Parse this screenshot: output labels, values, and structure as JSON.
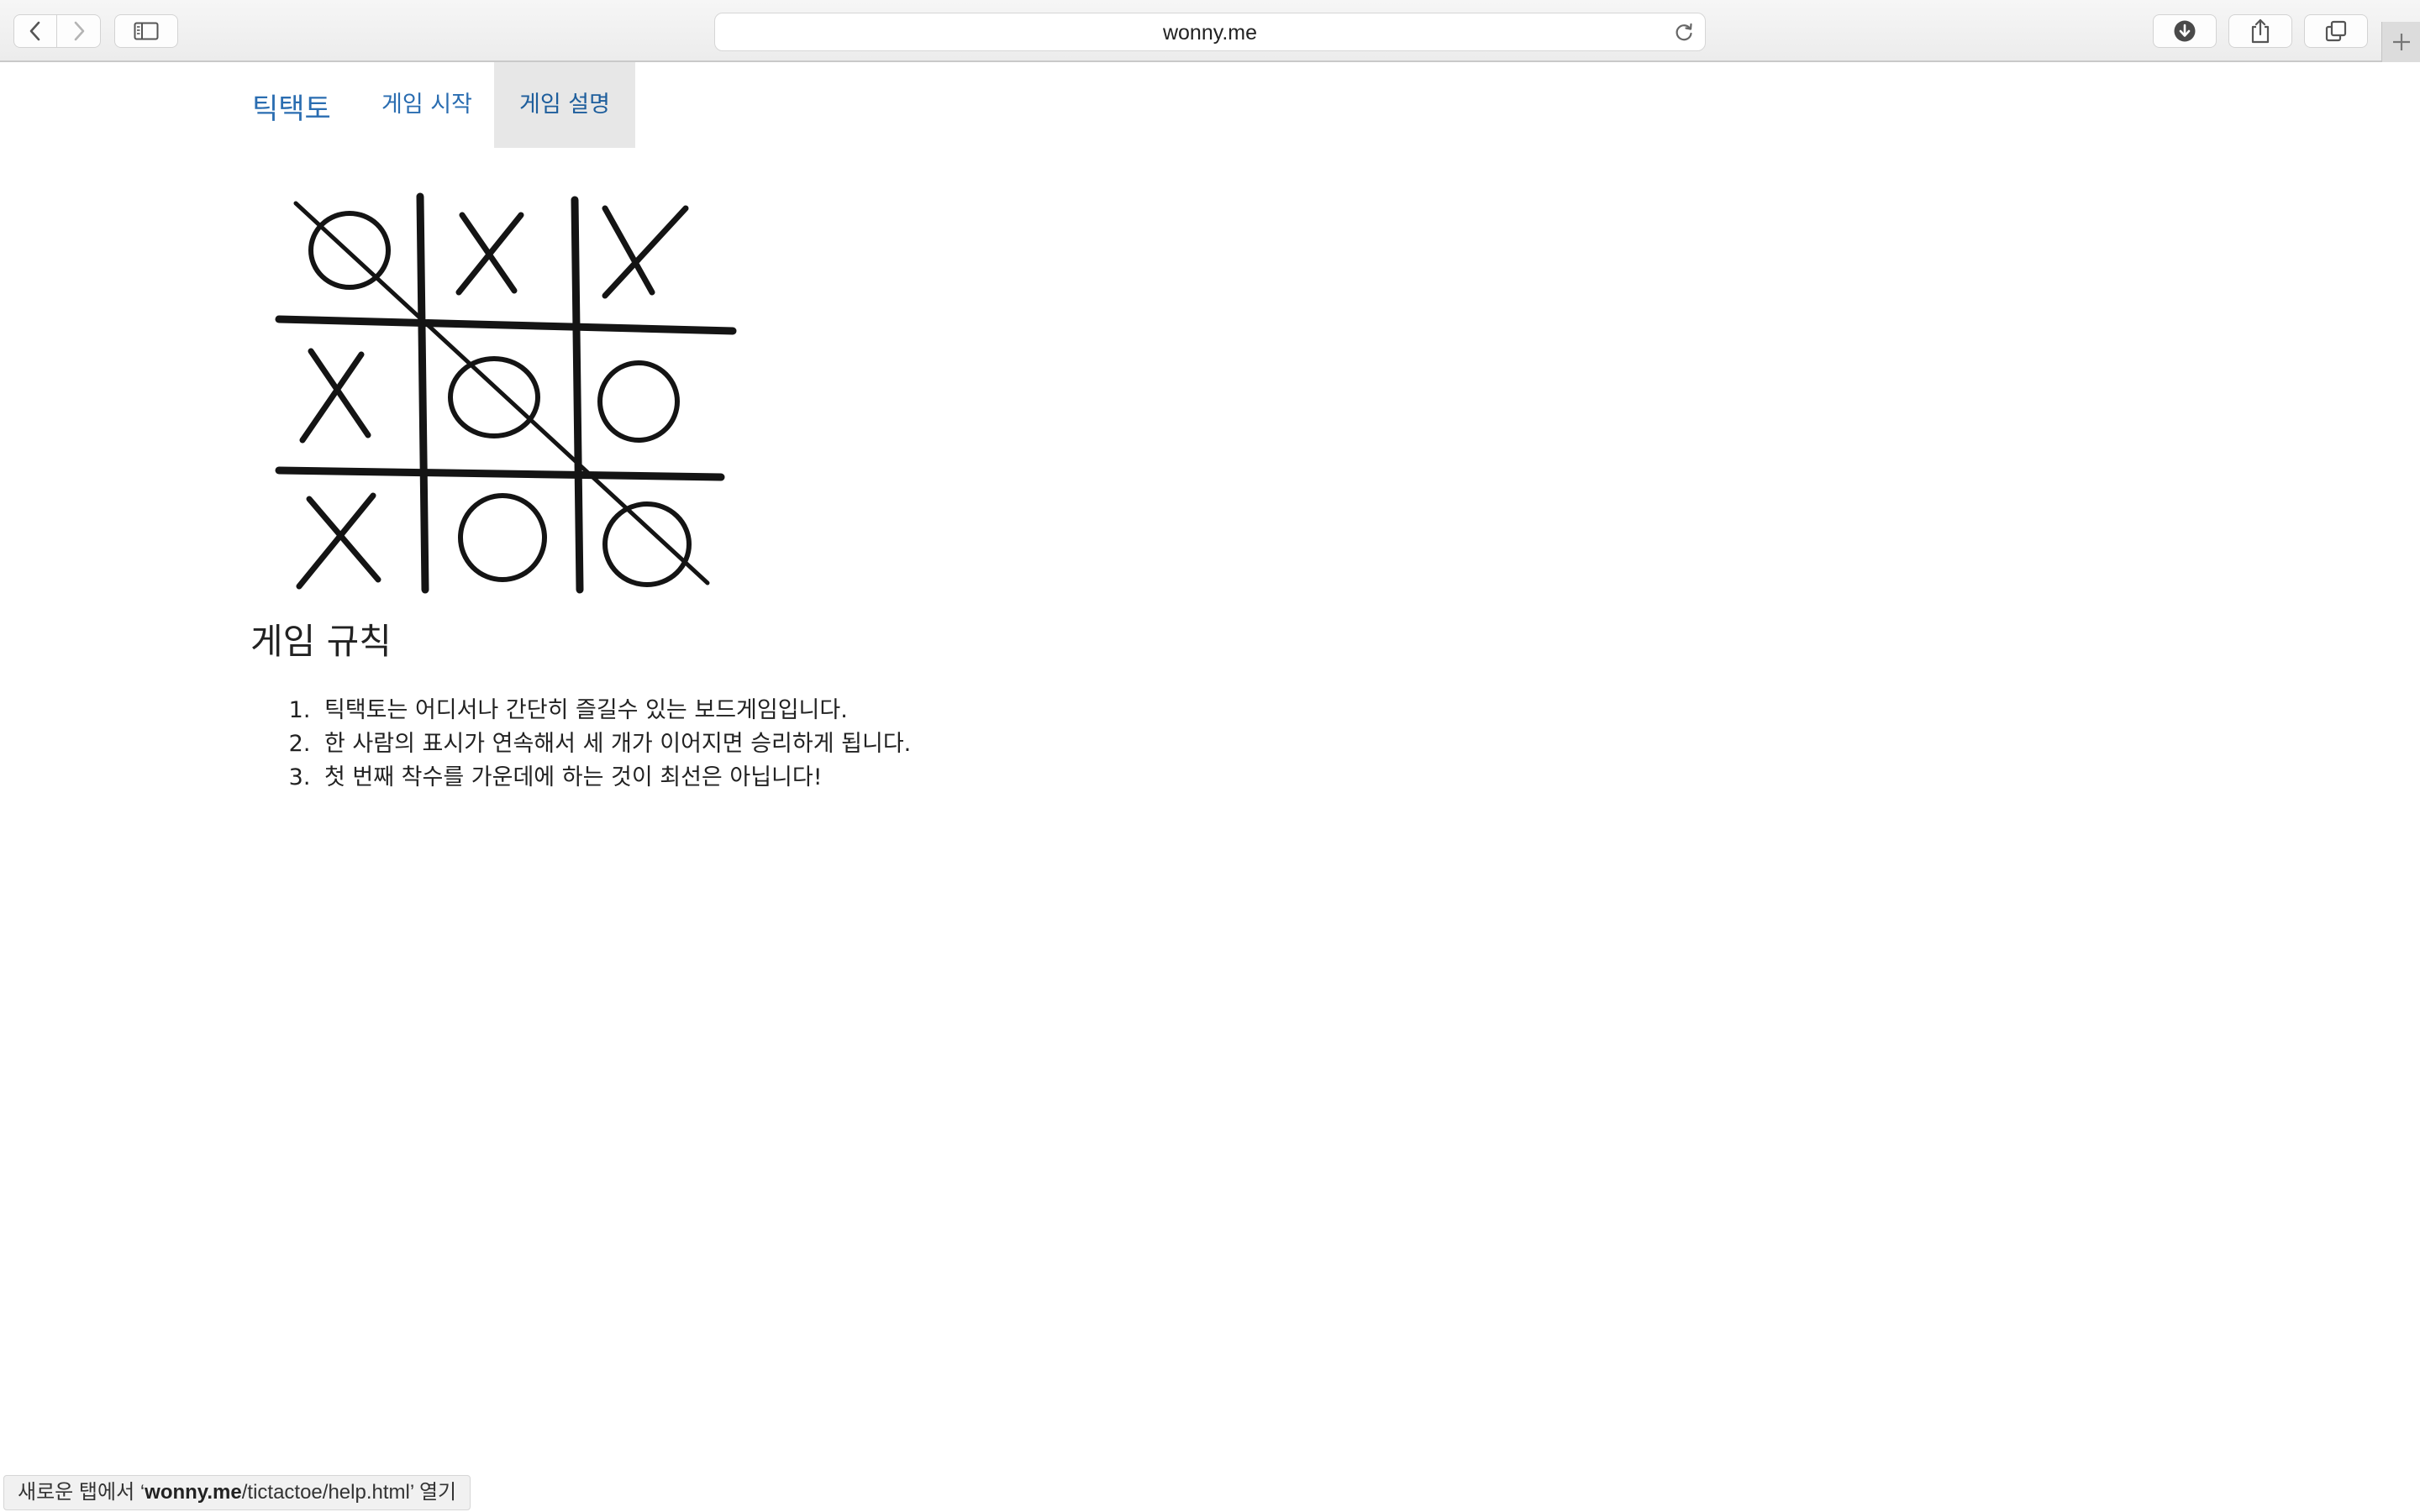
{
  "browser": {
    "address": "wonny.me"
  },
  "navbar": {
    "brand": "틱택토",
    "links": [
      {
        "label": "게임 시작",
        "active": false
      },
      {
        "label": "게임 설명",
        "active": true
      }
    ]
  },
  "content": {
    "board_image": {
      "grid": [
        [
          "O",
          "X",
          "X"
        ],
        [
          "X",
          "O",
          "O"
        ],
        [
          "X",
          "O",
          "O"
        ]
      ],
      "winning_line": "diagonal"
    },
    "rules_title": "게임 규칙",
    "rules": [
      "틱택토는 어디서나 간단히 즐길수 있는 보드게임입니다.",
      "한 사람의 표시가 연속해서 세 개가 이어지면 승리하게 됩니다.",
      "첫 번째 착수를 가운데에 하는 것이 최선은 아닙니다!"
    ]
  },
  "status_bar": {
    "prefix": "새로운 탭에서 ‘",
    "domain": "wonny.me",
    "path": "/tictactoe/help.html",
    "suffix": "’ 열기"
  },
  "colors": {
    "link": "#2a6db1",
    "active_tab_bg": "#e7e7e7",
    "text": "#222222"
  }
}
